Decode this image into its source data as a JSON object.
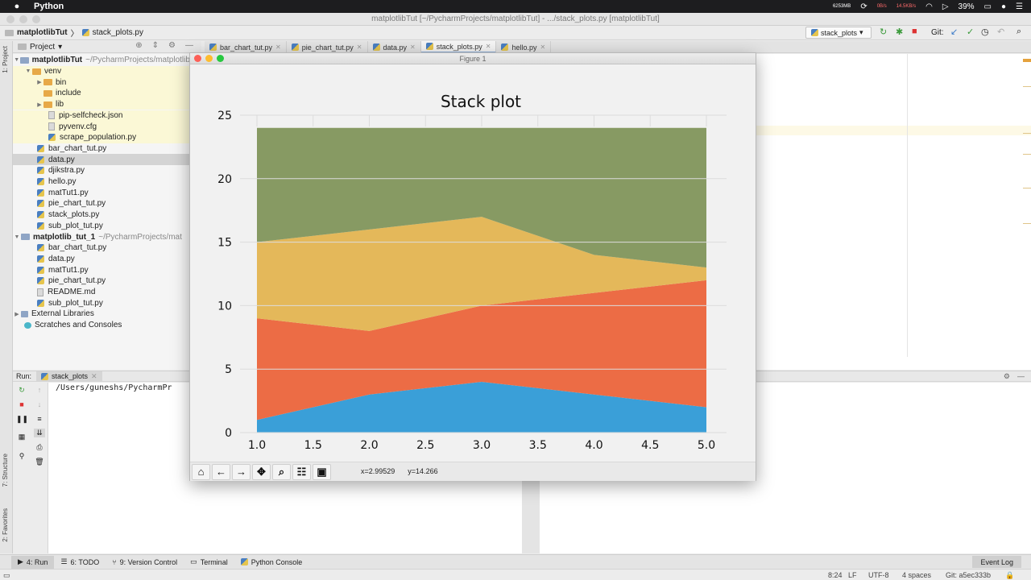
{
  "menubar": {
    "app": "Python",
    "memory": "6253MB",
    "net_up": "0B/s",
    "net_down": "14.5KB/s",
    "battery": "39%"
  },
  "window_title": "matplotlibTut [~/PycharmProjects/matplotlibTut] - .../stack_plots.py [matplotlibTut]",
  "breadcrumb": {
    "project": "matplotlibTut",
    "file": "stack_plots.py"
  },
  "run_config": "stack_plots",
  "git_label": "Git:",
  "project_panel": {
    "label": "Project"
  },
  "editor_tabs": [
    {
      "label": "bar_chart_tut.py",
      "active": false
    },
    {
      "label": "pie_chart_tut.py",
      "active": false
    },
    {
      "label": "data.py",
      "active": false
    },
    {
      "label": "stack_plots.py",
      "active": true
    },
    {
      "label": "hello.py",
      "active": false
    }
  ],
  "tree": {
    "root1": {
      "name": "matplotlibTut",
      "path": "~/PycharmProjects/matplotlibTut"
    },
    "venv": "venv",
    "bin": "bin",
    "include": "include",
    "lib": "lib",
    "pip_selfcheck": "pip-selfcheck.json",
    "pyvenv": "pyvenv.cfg",
    "scrape": "scrape_population.py",
    "files1": [
      "bar_chart_tut.py",
      "data.py",
      "djikstra.py",
      "hello.py",
      "matTut1.py",
      "pie_chart_tut.py",
      "stack_plots.py",
      "sub_plot_tut.py"
    ],
    "root2": {
      "name": "matplotlib_tut_1",
      "path": "~/PycharmProjects/mat"
    },
    "files2": [
      "bar_chart_tut.py",
      "data.py",
      "matTut1.py",
      "pie_chart_tut.py",
      "README.md",
      "sub_plot_tut.py"
    ],
    "external": "External Libraries",
    "scratches": "Scratches and Consoles"
  },
  "side_labels": {
    "project": "1: Project",
    "structure": "7: Structure",
    "favorites": "2: Favorites"
  },
  "run_panel": {
    "label": "Run:",
    "tab": "stack_plots",
    "console_text": "/Users/guneshs/PycharmPr"
  },
  "bottom_tools": {
    "run": "4: Run",
    "todo": "6: TODO",
    "vcs": "9: Version Control",
    "terminal": "Terminal",
    "python_console": "Python Console",
    "event_log": "Event Log"
  },
  "status": {
    "position": "8:24",
    "line_sep": "LF",
    "encoding": "UTF-8",
    "indent": "4 spaces",
    "git": "Git: a5ec333b"
  },
  "figure": {
    "window_title": "Figure 1",
    "coord_x": "x=2.99529",
    "coord_y": "y=14.266",
    "colors": [
      "#3a9fd8",
      "#ec6c45",
      "#e4b85a",
      "#879a63"
    ]
  },
  "chart_data": {
    "type": "area",
    "stacked": true,
    "title": "Stack plot",
    "xlabel": "",
    "ylabel": "",
    "x": [
      1,
      2,
      3,
      4,
      5
    ],
    "xlim": [
      1.0,
      5.0
    ],
    "ylim": [
      0,
      25
    ],
    "x_ticks": [
      "1.0",
      "1.5",
      "2.0",
      "2.5",
      "3.0",
      "3.5",
      "4.0",
      "4.5",
      "5.0"
    ],
    "y_ticks": [
      "0",
      "5",
      "10",
      "15",
      "20",
      "25"
    ],
    "grid": true,
    "series": [
      {
        "values": [
          1,
          3,
          4,
          3,
          2
        ],
        "color": "#3a9fd8"
      },
      {
        "values": [
          8,
          5,
          6,
          8,
          10
        ],
        "color": "#ec6c45"
      },
      {
        "values": [
          6,
          8,
          7,
          3,
          1
        ],
        "color": "#e4b85a"
      },
      {
        "values": [
          9,
          8,
          7,
          10,
          11
        ],
        "color": "#879a63"
      }
    ]
  }
}
